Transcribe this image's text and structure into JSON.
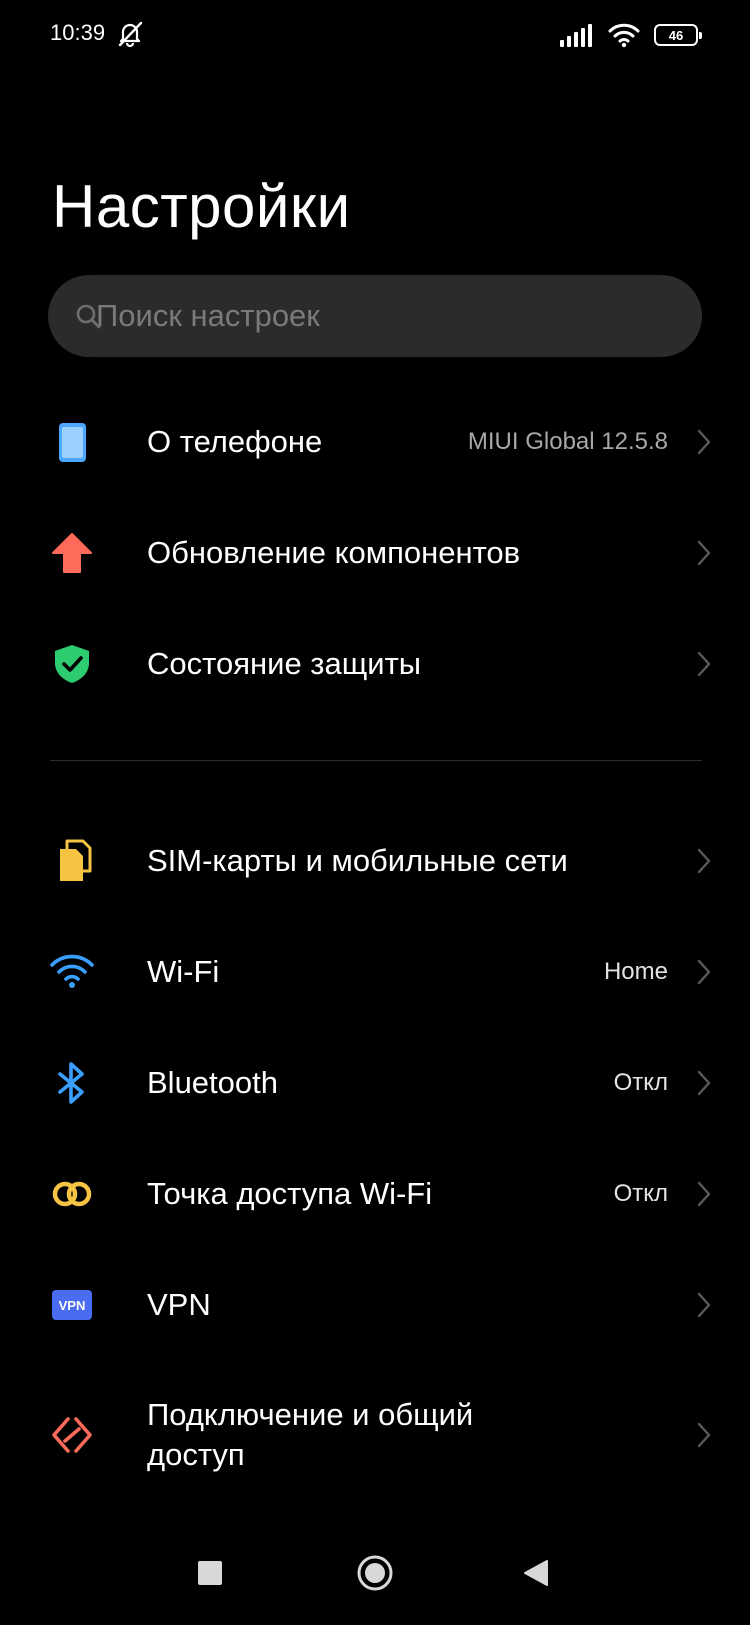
{
  "status_bar": {
    "time": "10:39",
    "battery": "46",
    "icons": [
      "mute-icon",
      "signal-icon",
      "wifi-icon",
      "battery-icon"
    ]
  },
  "header": {
    "title": "Настройки"
  },
  "search": {
    "placeholder": "Поиск настроек"
  },
  "settings": {
    "items": [
      {
        "label": "О телефоне",
        "value": "MIUI Global 12.5.8",
        "icon": "phone-icon"
      },
      {
        "label": "Обновление компонентов",
        "value": "",
        "icon": "update-arrow-icon"
      },
      {
        "label": "Состояние защиты",
        "value": "",
        "icon": "shield-check-icon"
      },
      {
        "label": "SIM-карты и мобильные сети",
        "value": "",
        "icon": "sim-card-icon"
      },
      {
        "label": "Wi-Fi",
        "value": "Home",
        "icon": "wifi-icon"
      },
      {
        "label": "Bluetooth",
        "value": "Откл",
        "icon": "bluetooth-icon"
      },
      {
        "label": "Точка доступа Wi-Fi",
        "value": "Откл",
        "icon": "hotspot-icon"
      },
      {
        "label": "VPN",
        "value": "",
        "icon": "vpn-icon",
        "badge": "VPN"
      },
      {
        "label": "Подключение и общий доступ",
        "value": "",
        "icon": "connection-sharing-icon"
      }
    ]
  },
  "colors": {
    "background": "#000000",
    "search_bg": "#2b2b2b",
    "phone": "#4da6ff",
    "update": "#ff6b5a",
    "shield": "#2ecc71",
    "sim": "#f6c343",
    "wifi": "#3aa0ff",
    "bluetooth": "#3aa0ff",
    "hotspot": "#f6c343",
    "vpn": "#4a6cf0",
    "share": "#ff6b5a"
  },
  "navigation": {
    "buttons": [
      "recents-square-icon",
      "home-circle-icon",
      "back-triangle-icon"
    ]
  }
}
